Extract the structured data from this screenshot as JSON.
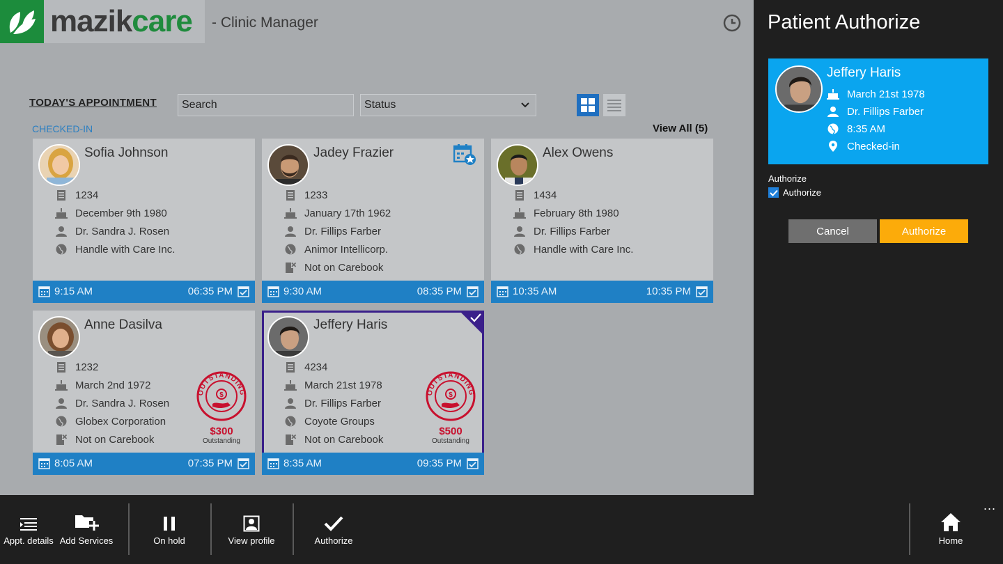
{
  "header": {
    "logo_prefix": "mazik",
    "logo_suffix": "care",
    "app_title": "- Clinic Manager"
  },
  "toolbar": {
    "section_title": "TODAY'S APPOINTMENT",
    "search_placeholder": "Search",
    "status_value": "Status",
    "group_label": "CHECKED-IN",
    "view_all": "View All (5)"
  },
  "appointments": [
    {
      "name": "Sofia Johnson",
      "id": "1234",
      "dob": "December 9th 1980",
      "doctor": "Dr. Sandra J. Rosen",
      "insurer": "Handle with Care Inc.",
      "start": "9:15 AM",
      "end": "06:35 PM"
    },
    {
      "name": "Jadey Frazier",
      "id": "1233",
      "dob": "January 17th 1962",
      "doctor": "Dr. Fillips Farber",
      "insurer": "Animor Intellicorp.",
      "carebook": "Not on Carebook",
      "start": "9:30 AM",
      "end": "08:35 PM"
    },
    {
      "name": "Alex Owens",
      "id": "1434",
      "dob": "February 8th 1980",
      "doctor": "Dr. Fillips Farber",
      "insurer": "Handle with Care Inc.",
      "start": "10:35 AM",
      "end": "10:35 PM"
    },
    {
      "name": "Anne Dasilva",
      "id": "1232",
      "dob": "March 2nd 1972",
      "doctor": "Dr. Sandra J. Rosen",
      "insurer": "Globex Corporation",
      "carebook": "Not on Carebook",
      "start": "8:05 AM",
      "end": "07:35 PM",
      "outstanding_amount": "$300",
      "outstanding_label": "Outstanding",
      "stamp_text": "OUTSTANDING"
    },
    {
      "name": "Jeffery Haris",
      "id": "4234",
      "dob": "March 21st 1978",
      "doctor": "Dr. Fillips Farber",
      "insurer": "Coyote Groups",
      "carebook": "Not on Carebook",
      "start": "8:35 AM",
      "end": "09:35 PM",
      "outstanding_amount": "$500",
      "outstanding_label": "Outstanding",
      "stamp_text": "OUTSTANDING",
      "selected": true
    }
  ],
  "panel": {
    "title": "Patient Authorize",
    "patient": {
      "name": "Jeffery Haris",
      "dob": "March 21st 1978",
      "doctor": "Dr. Fillips Farber",
      "time": "8:35 AM",
      "status": "Checked-in"
    },
    "authorize_heading": "Authorize",
    "authorize_checkbox_label": "Authorize",
    "authorize_checked": true,
    "cancel_label": "Cancel",
    "authorize_label": "Authorize"
  },
  "appbar": {
    "appt_details": "Appt. details",
    "add_services": "Add Services",
    "on_hold": "On hold",
    "view_profile": "View profile",
    "authorize": "Authorize",
    "home": "Home",
    "more": "..."
  },
  "colors": {
    "accent_blue": "#1f80c5",
    "panel_blue": "#0aa5ef",
    "brand_green": "#1f8b3d",
    "authorize_orange": "#fcab0a",
    "selected_outline": "#3a1f8a",
    "stamp_red": "#c8102e"
  }
}
